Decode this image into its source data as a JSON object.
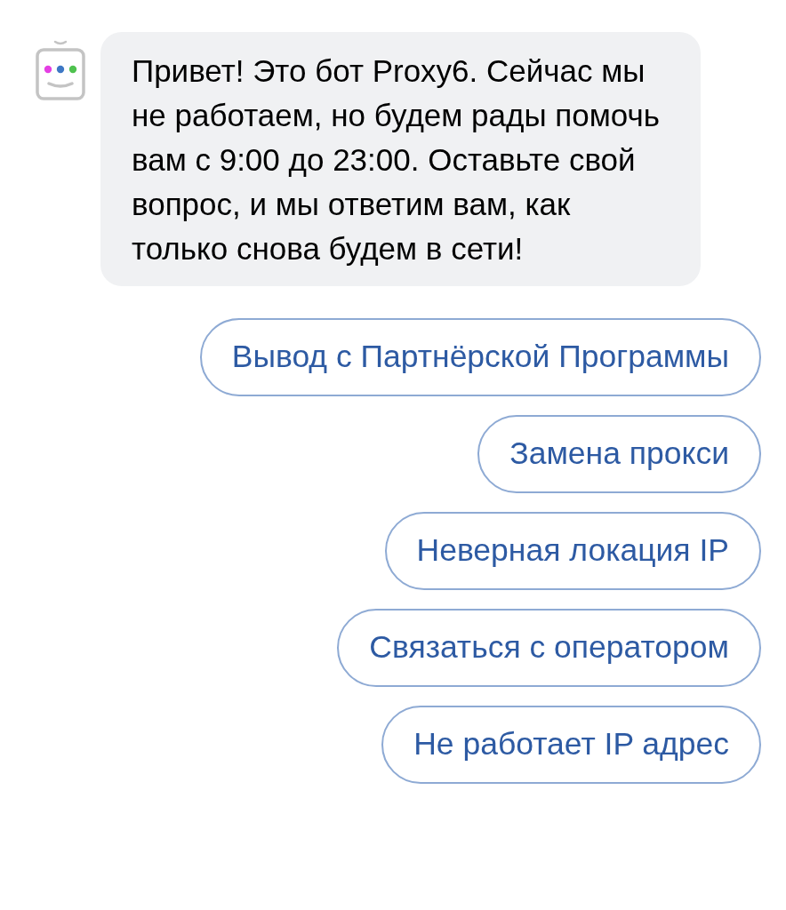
{
  "message": {
    "text": "Привет! Это бот Proxy6. Сейчас мы не работаем, но будем рады помочь вам с 9:00 до 23:00. Оставьте свой вопрос, и мы ответим вам, как только снова будем в сети!"
  },
  "buttons": [
    {
      "label": "Вывод с Партнёрской Программы"
    },
    {
      "label": "Замена прокси"
    },
    {
      "label": "Неверная локация IP"
    },
    {
      "label": "Связаться с оператором"
    },
    {
      "label": "Не работает IP адрес"
    }
  ]
}
